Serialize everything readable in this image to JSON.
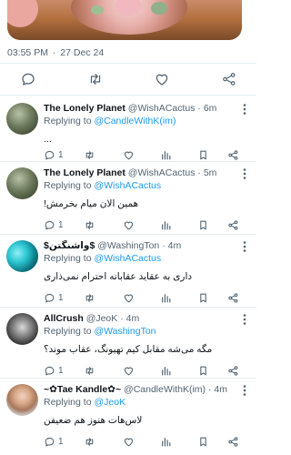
{
  "post": {
    "timestamp_time": "03:55 PM",
    "timestamp_sep": "·",
    "timestamp_date": "27 Dec 24"
  },
  "replies": [
    {
      "display_name": "The Lonely Planet",
      "handle": "@WishACactus",
      "time": "6m",
      "replying_label": "Replying to",
      "replying_to": "@CandleWithK(im)",
      "text": "...",
      "reply_count": "1",
      "avatar": "moss"
    },
    {
      "display_name": "The Lonely Planet",
      "handle": "@WishACactus",
      "time": "5m",
      "replying_label": "Replying to",
      "replying_to": "@WishACactus",
      "text": "همین الان میام بخرمش!",
      "reply_count": "1",
      "avatar": "moss"
    },
    {
      "display_name": "$واشنگتن$",
      "handle": "@WashingTon",
      "time": "4m",
      "replying_label": "Replying to",
      "replying_to": "@WishACactus",
      "text": "داری به عقاید عقابانه احترام نمی‌ذاری",
      "reply_count": "1",
      "avatar": "teal"
    },
    {
      "display_name": "AllCrush",
      "handle": "@JeoK",
      "time": "4m",
      "replying_label": "Replying to",
      "replying_to": "@WashingTon",
      "text": "مگه می‌شه مقابل کیم تهیونگ، عقاب موند؟",
      "reply_count": "1",
      "avatar": "mono"
    },
    {
      "display_name": "~✿Tae Kandle✿~",
      "handle": "@CandleWithK(im)",
      "time": "4m",
      "replying_label": "Replying to",
      "replying_to": "@JeoK",
      "text": "لاس‌هات هنوز هم ضعیفن",
      "reply_count": "1",
      "avatar": "person"
    }
  ],
  "icons": {
    "reply": "reply-icon",
    "retweet": "retweet-icon",
    "like": "heart-icon",
    "views": "views-icon",
    "share": "share-icon",
    "more": "more-vertical-icon"
  },
  "colors": {
    "accent": "#1d9bf0",
    "muted": "#536471",
    "text": "#0f1419",
    "divider": "#e6ecf0"
  }
}
